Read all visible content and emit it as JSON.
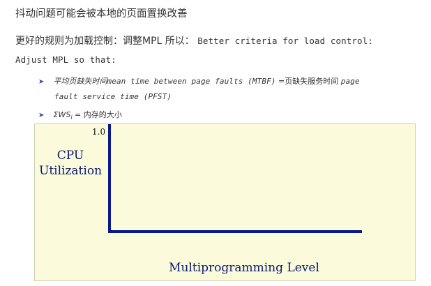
{
  "heading": "抖动问题可能会被本地的页面置换改善",
  "line2_cn": "更好的规则为加载控制：调整MPL 所以：",
  "line2_en": "Better criteria for load control:",
  "line3": "Adjust MPL so that:",
  "bullets": [
    {
      "cn": "平均页缺失时间",
      "en": "mean time between page faults (MTBF)",
      "eq_cn": "=页缺失服务时间",
      "en2": "page",
      "en3": "fault service time (PFST)"
    },
    {
      "sym": "ΣWS",
      "sub": "i",
      "eq": "= 内存的大小"
    }
  ],
  "chart_data": {
    "type": "line",
    "ytick": "1.0",
    "ylabel_line1": "CPU",
    "ylabel_line2": "Utilization",
    "xlabel": "Multiprogramming Level"
  },
  "colors": {
    "axis": "#0a1a8c",
    "chart_bg": "#fbfbdc",
    "label": "#0a1a6e",
    "bullet_arrow": "#3a3fb0"
  }
}
